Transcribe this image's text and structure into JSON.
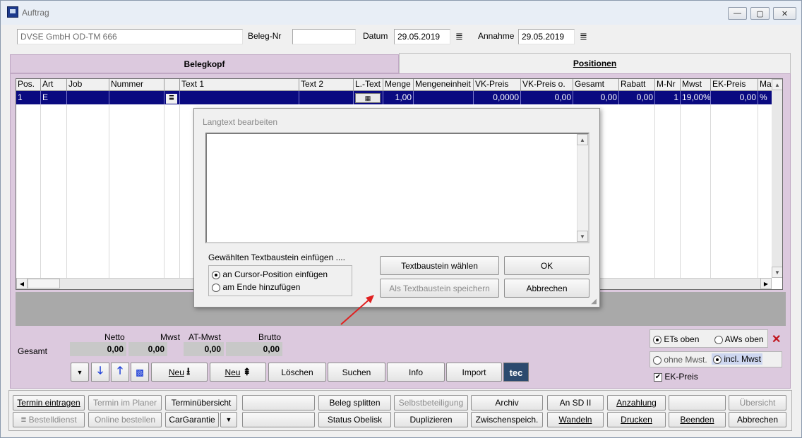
{
  "window": {
    "title": "Auftrag",
    "minimize": "—",
    "maximize": "▢",
    "close": "✕"
  },
  "header": {
    "customer": "DVSE GmbH OD-TM 666",
    "beleg_label": "Beleg-Nr",
    "beleg_value": "",
    "datum_label": "Datum",
    "datum_value": "29.05.2019",
    "annahme_label": "Annahme",
    "annahme_value": "29.05.2019"
  },
  "tabs": [
    {
      "label": "Belegkopf"
    },
    {
      "label": "Positionen"
    }
  ],
  "grid": {
    "columns": [
      "Pos.",
      "Art",
      "Job",
      "Nummer",
      "",
      "Text 1",
      "Text 2",
      "L.-Text",
      "Menge",
      "Mengeneinheit",
      "VK-Preis",
      "VK-Preis o.",
      "Gesamt",
      "Rabatt",
      "M-Nr",
      "Mwst",
      "EK-Preis",
      "Ma"
    ],
    "row": {
      "pos": "1",
      "art": "E",
      "menge": "1,00",
      "vk": "0,0000",
      "vko": "0,00",
      "gesamt": "0,00",
      "rabatt": "0,00",
      "mnr": "1",
      "mwst": "19,00%",
      "ek": "0,00",
      "ma": "%"
    }
  },
  "dialog": {
    "title": "Langtext bearbeiten",
    "group_title": "Gewählten Textbaustein einfügen ....",
    "radio1": "an Cursor-Position einfügen",
    "radio2": "am Ende hinzufügen",
    "btn_choose": "Textbaustein wählen",
    "btn_ok": "OK",
    "btn_save": "Als Textbaustein speichern",
    "btn_cancel": "Abbrechen"
  },
  "totals": {
    "label": "Gesamt",
    "netto_label": "Netto",
    "netto": "0,00",
    "mwst_label": "Mwst",
    "mwst": "0,00",
    "atmwst_label": "AT-Mwst",
    "atmwst": "0,00",
    "brutto_label": "Brutto",
    "brutto": "0,00"
  },
  "toolbar": {
    "neu1": "Neu",
    "neu2": "Neu",
    "loeschen": "Löschen",
    "suchen": "Suchen",
    "info": "Info",
    "import": "Import",
    "tec_logo": "tec"
  },
  "options": {
    "ets_oben": "ETs oben",
    "aws_oben": "AWs oben",
    "ohne_mwst": "ohne Mwst.",
    "incl_mwst": "incl. Mwst",
    "ek_preis": "EK-Preis"
  },
  "bottom": {
    "row1": [
      "Termin eintragen",
      "Termin im Planer",
      "Terminübersicht",
      "",
      "Beleg splitten",
      "Selbstbeteiligung",
      "Archiv",
      "An SD II",
      "Anzahlung",
      "",
      "Übersicht"
    ],
    "row2": [
      "Bestelldienst",
      "Online bestellen",
      "CarGarantie",
      "",
      "Status Obelisk",
      "Duplizieren",
      "Zwischenspeich.",
      "Wandeln",
      "Drucken",
      "Beenden",
      "Abbrechen"
    ]
  }
}
